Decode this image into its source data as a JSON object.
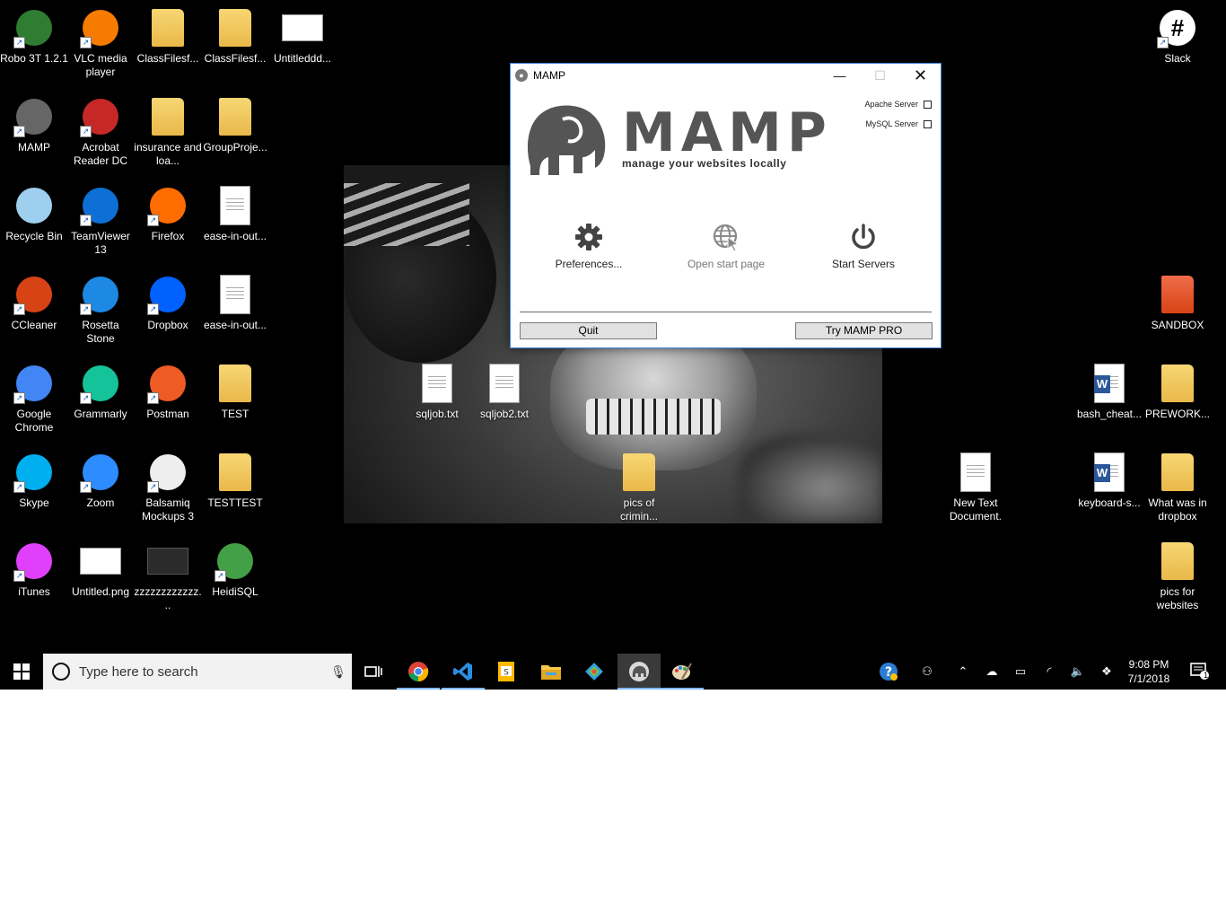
{
  "desktop": {
    "icons_left": [
      {
        "label": "Robo 3T 1.2.1",
        "icon": "robot-icon",
        "color": "#2e7d32"
      },
      {
        "label": "VLC media player",
        "icon": "vlc-cone-icon",
        "color": "#f57c00"
      },
      {
        "label": "ClassFilesf...",
        "icon": "folder-icon",
        "color": "#f7d774"
      },
      {
        "label": "ClassFilesf...",
        "icon": "folder-icon",
        "color": "#f7d774"
      },
      {
        "label": "Untitleddd...",
        "icon": "image-thumbnail-icon",
        "color": "#ffffff"
      },
      {
        "label": "MAMP",
        "icon": "mamp-elephant-icon",
        "color": "#666666"
      },
      {
        "label": "Acrobat Reader DC",
        "icon": "acrobat-icon",
        "color": "#c62828"
      },
      {
        "label": "insurance and loa...",
        "icon": "folder-icon",
        "color": "#f7d774"
      },
      {
        "label": "GroupProje...",
        "icon": "folder-icon",
        "color": "#f7d774"
      },
      {
        "label": "Recycle Bin",
        "icon": "recycle-bin-icon",
        "color": "#9ecfef"
      },
      {
        "label": "TeamViewer 13",
        "icon": "teamviewer-icon",
        "color": "#0e6fd6"
      },
      {
        "label": "Firefox",
        "icon": "firefox-icon",
        "color": "#ff6d00"
      },
      {
        "label": "ease-in-out...",
        "icon": "document-icon",
        "color": "#ffffff"
      },
      {
        "label": "CCleaner",
        "icon": "ccleaner-icon",
        "color": "#d84315"
      },
      {
        "label": "Rosetta Stone",
        "icon": "rosetta-stone-icon",
        "color": "#1e88e5"
      },
      {
        "label": "Dropbox",
        "icon": "dropbox-icon",
        "color": "#0061fe"
      },
      {
        "label": "ease-in-out...",
        "icon": "document-icon",
        "color": "#ffffff"
      },
      {
        "label": "Google Chrome",
        "icon": "chrome-icon",
        "color": "#4285f4"
      },
      {
        "label": "Grammarly",
        "icon": "grammarly-icon",
        "color": "#15c39a"
      },
      {
        "label": "Postman",
        "icon": "postman-icon",
        "color": "#ef5b25"
      },
      {
        "label": "TEST",
        "icon": "folder-icon",
        "color": "#f7d774"
      },
      {
        "label": "Skype",
        "icon": "skype-icon",
        "color": "#00aff0"
      },
      {
        "label": "Zoom",
        "icon": "zoom-icon",
        "color": "#2d8cff"
      },
      {
        "label": "Balsamiq Mockups 3",
        "icon": "balsamiq-icon",
        "color": "#eeeeee"
      },
      {
        "label": "TESTTEST",
        "icon": "folder-icon",
        "color": "#f7d774"
      },
      {
        "label": "iTunes",
        "icon": "itunes-icon",
        "color": "#e040fb"
      },
      {
        "label": "Untitled.png",
        "icon": "image-thumbnail-icon",
        "color": "#ffffff"
      },
      {
        "label": "zzzzzzzzzzzz...",
        "icon": "image-thumbnail-icon",
        "color": "#2b2b2b"
      },
      {
        "label": "HeidiSQL",
        "icon": "heidisql-icon",
        "color": "#43a047"
      }
    ],
    "icons_middle": [
      {
        "label": "sqljob.txt",
        "icon": "text-file-icon"
      },
      {
        "label": "sqljob2.txt",
        "icon": "text-file-icon"
      },
      {
        "label": "pics of crimin...",
        "icon": "folder-icon"
      },
      {
        "label": "New Text Document.",
        "icon": "text-file-icon"
      }
    ],
    "icons_right": [
      {
        "label": "Slack",
        "icon": "slack-icon"
      },
      {
        "label": "SANDBOX",
        "icon": "sandbox-folder-icon"
      },
      {
        "label": "bash_cheat...",
        "icon": "word-doc-icon"
      },
      {
        "label": "PREWORK...",
        "icon": "folder-icon"
      },
      {
        "label": "keyboard-s...",
        "icon": "word-doc-icon"
      },
      {
        "label": "What was in dropbox",
        "icon": "folder-icon"
      },
      {
        "label": "pics for websites",
        "icon": "folder-icon"
      }
    ]
  },
  "mamp": {
    "title": "MAMP",
    "brand": "MAMP",
    "tagline": "manage your websites locally",
    "apache_label": "Apache Server",
    "mysql_label": "MySQL Server",
    "preferences_label": "Preferences...",
    "open_start_page_label": "Open start page",
    "start_servers_label": "Start Servers",
    "quit_label": "Quit",
    "try_pro_label": "Try MAMP PRO"
  },
  "taskbar": {
    "search_placeholder": "Type here to search",
    "pinned": [
      {
        "icon": "task-view-icon"
      },
      {
        "icon": "chrome-icon"
      },
      {
        "icon": "vscode-icon"
      },
      {
        "icon": "slides-icon"
      },
      {
        "icon": "file-explorer-icon"
      },
      {
        "icon": "gitkraken-icon"
      },
      {
        "icon": "mamp-elephant-icon"
      },
      {
        "icon": "paint-icon"
      }
    ],
    "time": "9:08 PM",
    "date": "7/1/2018",
    "notification_count": "1"
  },
  "colors": {
    "desktop_bg": "#000000",
    "window_border": "#3c85d6",
    "taskbar_bg": "#000000",
    "search_bg": "#f2f2f2"
  }
}
